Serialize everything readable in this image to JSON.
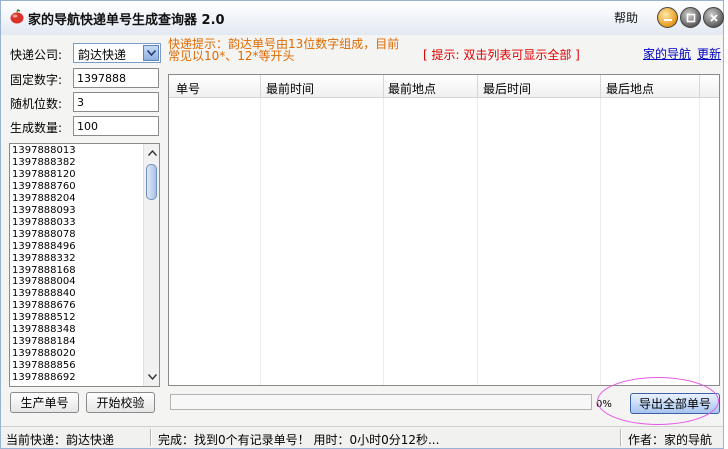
{
  "window": {
    "title": "家的导航快递单号生成查询器 2.0",
    "help": "帮助"
  },
  "form": {
    "company_label": "快递公司:",
    "company_value": "韵达快递",
    "fixed_label": "固定数字:",
    "fixed_value": "1397888",
    "random_label": "随机位数:",
    "random_value": "3",
    "count_label": "生成数量:",
    "count_value": "100"
  },
  "numbers": [
    "1397888013",
    "1397888382",
    "1397888120",
    "1397888760",
    "1397888204",
    "1397888093",
    "1397888033",
    "1397888078",
    "1397888496",
    "1397888332",
    "1397888168",
    "1397888004",
    "1397888840",
    "1397888676",
    "1397888512",
    "1397888348",
    "1397888184",
    "1397888020",
    "1397888856",
    "1397888692"
  ],
  "buttons": {
    "generate": "生产单号",
    "verify": "开始校验",
    "export": "导出全部单号"
  },
  "tips": {
    "line1": "快递提示：韵达单号由13位数字组成，目前",
    "line2": "常见以10*、12*等开头",
    "hint": "[ 提示:  双击列表可显示全部 ]"
  },
  "links": {
    "home": "家的导航",
    "update": "更新"
  },
  "grid": {
    "columns": [
      "单号",
      "最前时间",
      "最前地点",
      "最后时间",
      "最后地点"
    ],
    "rows": []
  },
  "progress": {
    "value": 0,
    "label": "0%"
  },
  "status": {
    "current": "当前快递：韵达快递",
    "result": "完成：找到0个有记录单号！ 用时：0小时0分12秒...",
    "author": "作者：家的导航"
  },
  "colors": {
    "tip": "#e06a00",
    "hint": "#e00000",
    "link": "#0000c0",
    "highlight_ellipse": "#e657e8"
  }
}
